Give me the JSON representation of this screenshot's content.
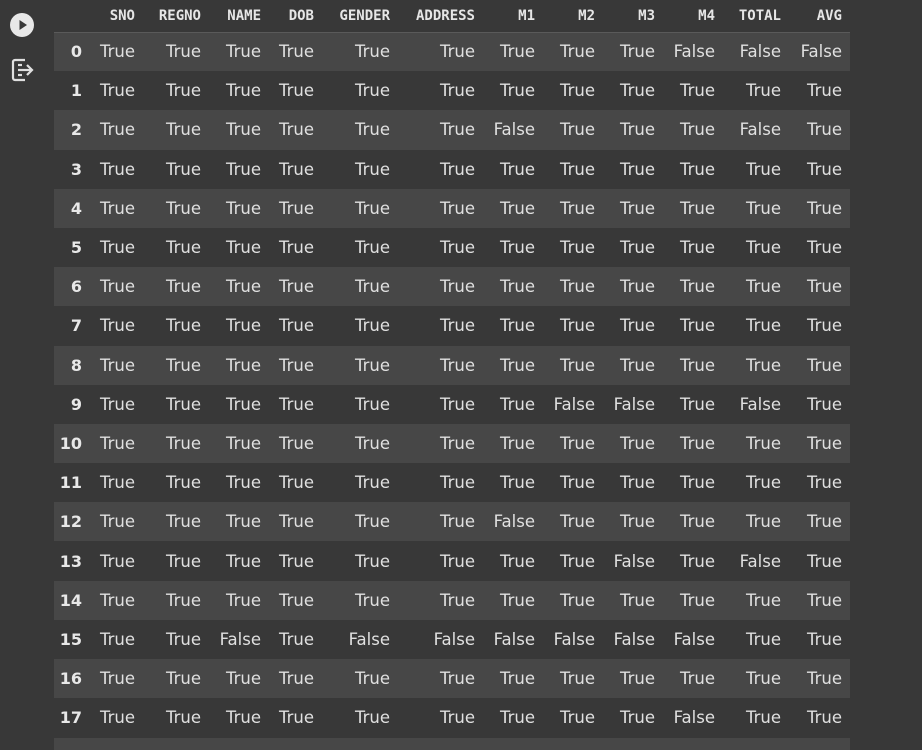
{
  "toolbar": {
    "run_icon": "play-circle-icon",
    "output_icon": "output-redirect-icon"
  },
  "colors": {
    "background": "#383838",
    "row_alt": "#474747",
    "text": "#e8e8e8"
  },
  "table": {
    "columns": [
      "SNO",
      "REGNO",
      "NAME",
      "DOB",
      "GENDER",
      "ADDRESS",
      "M1",
      "M2",
      "M3",
      "M4",
      "TOTAL",
      "AVG"
    ],
    "rows": [
      {
        "index": "0",
        "cells": [
          "True",
          "True",
          "True",
          "True",
          "True",
          "True",
          "True",
          "True",
          "True",
          "False",
          "False",
          "False"
        ]
      },
      {
        "index": "1",
        "cells": [
          "True",
          "True",
          "True",
          "True",
          "True",
          "True",
          "True",
          "True",
          "True",
          "True",
          "True",
          "True"
        ]
      },
      {
        "index": "2",
        "cells": [
          "True",
          "True",
          "True",
          "True",
          "True",
          "True",
          "False",
          "True",
          "True",
          "True",
          "False",
          "True"
        ]
      },
      {
        "index": "3",
        "cells": [
          "True",
          "True",
          "True",
          "True",
          "True",
          "True",
          "True",
          "True",
          "True",
          "True",
          "True",
          "True"
        ]
      },
      {
        "index": "4",
        "cells": [
          "True",
          "True",
          "True",
          "True",
          "True",
          "True",
          "True",
          "True",
          "True",
          "True",
          "True",
          "True"
        ]
      },
      {
        "index": "5",
        "cells": [
          "True",
          "True",
          "True",
          "True",
          "True",
          "True",
          "True",
          "True",
          "True",
          "True",
          "True",
          "True"
        ]
      },
      {
        "index": "6",
        "cells": [
          "True",
          "True",
          "True",
          "True",
          "True",
          "True",
          "True",
          "True",
          "True",
          "True",
          "True",
          "True"
        ]
      },
      {
        "index": "7",
        "cells": [
          "True",
          "True",
          "True",
          "True",
          "True",
          "True",
          "True",
          "True",
          "True",
          "True",
          "True",
          "True"
        ]
      },
      {
        "index": "8",
        "cells": [
          "True",
          "True",
          "True",
          "True",
          "True",
          "True",
          "True",
          "True",
          "True",
          "True",
          "True",
          "True"
        ]
      },
      {
        "index": "9",
        "cells": [
          "True",
          "True",
          "True",
          "True",
          "True",
          "True",
          "True",
          "False",
          "False",
          "True",
          "False",
          "True"
        ]
      },
      {
        "index": "10",
        "cells": [
          "True",
          "True",
          "True",
          "True",
          "True",
          "True",
          "True",
          "True",
          "True",
          "True",
          "True",
          "True"
        ]
      },
      {
        "index": "11",
        "cells": [
          "True",
          "True",
          "True",
          "True",
          "True",
          "True",
          "True",
          "True",
          "True",
          "True",
          "True",
          "True"
        ]
      },
      {
        "index": "12",
        "cells": [
          "True",
          "True",
          "True",
          "True",
          "True",
          "True",
          "False",
          "True",
          "True",
          "True",
          "True",
          "True"
        ]
      },
      {
        "index": "13",
        "cells": [
          "True",
          "True",
          "True",
          "True",
          "True",
          "True",
          "True",
          "True",
          "False",
          "True",
          "False",
          "True"
        ]
      },
      {
        "index": "14",
        "cells": [
          "True",
          "True",
          "True",
          "True",
          "True",
          "True",
          "True",
          "True",
          "True",
          "True",
          "True",
          "True"
        ]
      },
      {
        "index": "15",
        "cells": [
          "True",
          "True",
          "False",
          "True",
          "False",
          "False",
          "False",
          "False",
          "False",
          "False",
          "True",
          "True"
        ]
      },
      {
        "index": "16",
        "cells": [
          "True",
          "True",
          "True",
          "True",
          "True",
          "True",
          "True",
          "True",
          "True",
          "True",
          "True",
          "True"
        ]
      },
      {
        "index": "17",
        "cells": [
          "True",
          "True",
          "True",
          "True",
          "True",
          "True",
          "True",
          "True",
          "True",
          "False",
          "True",
          "True"
        ]
      }
    ]
  }
}
